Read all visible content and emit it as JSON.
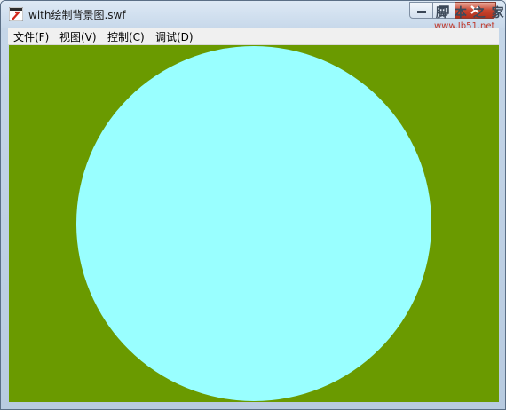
{
  "window": {
    "title": "with绘制背景图.swf",
    "app_icon": "flash-player-icon",
    "controls": {
      "minimize": "minimize-icon",
      "maximize": "maximize-icon",
      "close": "close-icon"
    }
  },
  "watermark": {
    "text": "脚 本 之 家",
    "url": "www.Jb51.net"
  },
  "menu": [
    {
      "label": "文件(F)"
    },
    {
      "label": "视图(V)"
    },
    {
      "label": "控制(C)"
    },
    {
      "label": "调试(D)"
    }
  ],
  "stage": {
    "background_color": "#6a9a00",
    "circle_color": "#99ffff"
  }
}
